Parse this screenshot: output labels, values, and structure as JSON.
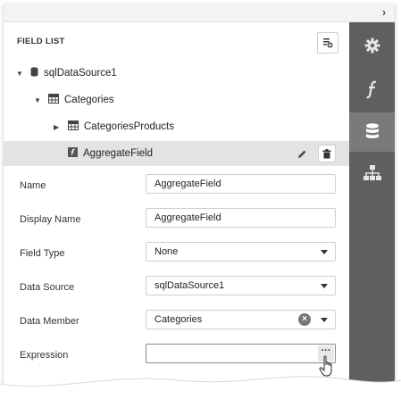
{
  "panel": {
    "header": "FIELD LIST",
    "header_action_icon": "add-calculated-field-icon"
  },
  "tree": {
    "datasource": "sqlDataSource1",
    "table": "Categories",
    "relation": "CategoriesProducts",
    "selected_field": "AggregateField"
  },
  "properties": {
    "name": {
      "label": "Name",
      "value": "AggregateField"
    },
    "display_name": {
      "label": "Display Name",
      "value": "AggregateField"
    },
    "field_type": {
      "label": "Field Type",
      "value": "None"
    },
    "data_source": {
      "label": "Data Source",
      "value": "sqlDataSource1"
    },
    "data_member": {
      "label": "Data Member",
      "value": "Categories"
    },
    "expression": {
      "label": "Expression",
      "value": "",
      "button": "···"
    }
  },
  "rail": {
    "items": [
      "settings-icon",
      "function-icon",
      "database-icon",
      "hierarchy-icon"
    ],
    "active": "database-icon"
  },
  "colors": {
    "rail_bg": "#5f5f5f",
    "rail_active": "#7a7a7a",
    "selected_row": "#e3e3e3"
  }
}
